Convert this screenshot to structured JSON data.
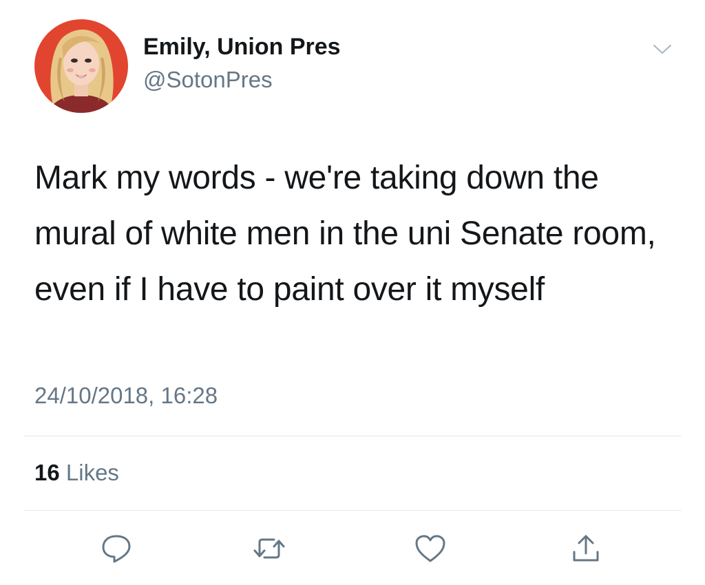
{
  "tweet": {
    "author": {
      "display_name": "Emily, Union Pres",
      "handle": "@SotonPres"
    },
    "text": "Mark my words - we're taking down the mural of white men in the uni Senate room, even if I have to paint over it myself",
    "timestamp": "24/10/2018, 16:28",
    "likes": {
      "count": "16",
      "label": "Likes"
    }
  },
  "icons": {
    "menu": "chevron-down-icon",
    "reply": "reply-icon",
    "retweet": "retweet-icon",
    "like": "heart-icon",
    "share": "share-icon"
  },
  "colors": {
    "primary_text": "#14171a",
    "secondary_text": "#657786",
    "divider": "#e1e8ed",
    "avatar_background": "#e2452f"
  }
}
